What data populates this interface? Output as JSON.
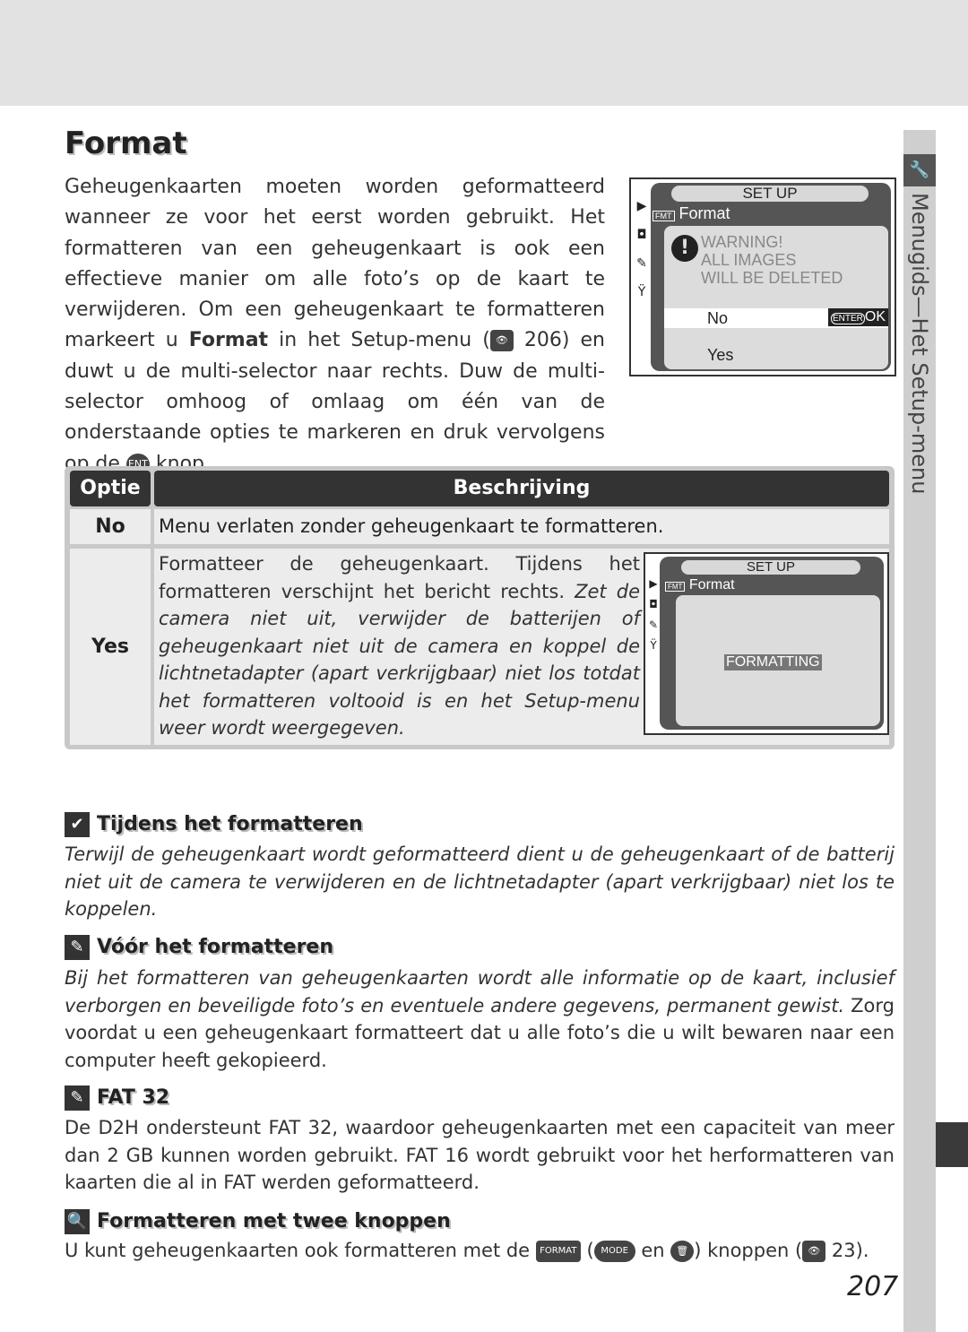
{
  "page": {
    "title": "Format",
    "number": "207"
  },
  "sidetab": {
    "label": "Menugids—Het Setup-menu",
    "icon": "wrench-icon"
  },
  "intro": {
    "p1": "Geheugenkaarten moeten worden geformatteerd wanneer ze voor het eerst worden gebruikt. Het formatteren van een geheugenkaart is ook een effectieve manier om alle foto’s op de kaart te verwijderen. Om een geheugenkaart te formatteren markeert u ",
    "bold": "Format",
    "p2": " in het Setup-menu (",
    "ref": "206",
    "p3": ") en duwt u de multi-selector naar rechts. Duw de multi-selector omhoog of omlaag om één van de onderstaande opties te markeren en druk vervolgens op de ",
    "p4": " knop."
  },
  "lcd1": {
    "title": "SET UP",
    "menu": "Format",
    "warning": [
      "WARNING!",
      "ALL IMAGES",
      "WILL BE DELETED"
    ],
    "no": "No",
    "ok": "OK",
    "enter": "ENTER",
    "yes": "Yes"
  },
  "lcd2": {
    "title": "SET UP",
    "menu": "Format",
    "status": "FORMATTING"
  },
  "table": {
    "headers": [
      "Optie",
      "Beschrijving"
    ],
    "rows": [
      {
        "option": "No",
        "desc": "Menu verlaten zonder geheugenkaart te formatteren."
      },
      {
        "option": "Yes",
        "desc": "Formatteer de geheugenkaart. Tijdens het formatteren verschijnt het bericht rechts. ",
        "desc_italic": "Zet de camera niet uit, verwijder de batterijen of geheugenkaart niet uit de camera en koppel de lichtnetadapter (apart verkrijgbaar) niet los totdat het formatteren voltooid is en het Setup-menu weer wordt weergegeven."
      }
    ]
  },
  "notes": [
    {
      "title": "Tijdens het formatteren",
      "icon": "check-icon",
      "italic": "Terwijl de geheugenkaart wordt geformatteerd dient u de geheugenkaart of de batterij niet uit de camera te verwijderen en de lichtnetadapter (apart verkrijgbaar) niet los te koppelen.",
      "text": ""
    },
    {
      "title": "Vóór het formatteren",
      "icon": "note-icon",
      "italic": "Bij het formatteren van geheugenkaarten wordt alle informatie op de kaart, inclusief verborgen en beveiligde foto’s en eventuele andere gegevens, permanent gewist.",
      "text": " Zorg voordat u een geheugenkaart formatteert dat u alle foto’s die u wilt bewaren naar een computer heeft gekopieerd."
    },
    {
      "title": "FAT 32",
      "icon": "note-icon",
      "italic": "",
      "text": "De D2H ondersteunt FAT 32, waardoor geheugenkaarten met een capaciteit van meer dan 2 GB kunnen worden gebruikt. FAT 16 wordt gebruikt voor het herformatteren van kaarten die al in FAT werden geformatteerd."
    },
    {
      "title": "Formatteren met twee knoppen",
      "icon": "magnifier-icon",
      "t1": "U kunt geheugenkaarten ook formatteren met de ",
      "t2": " (",
      "t3": " en ",
      "t4": ") knoppen (",
      "ref": "23",
      "t5": ").",
      "btn_format": "FORMAT",
      "btn_mode": "MODE"
    }
  ]
}
